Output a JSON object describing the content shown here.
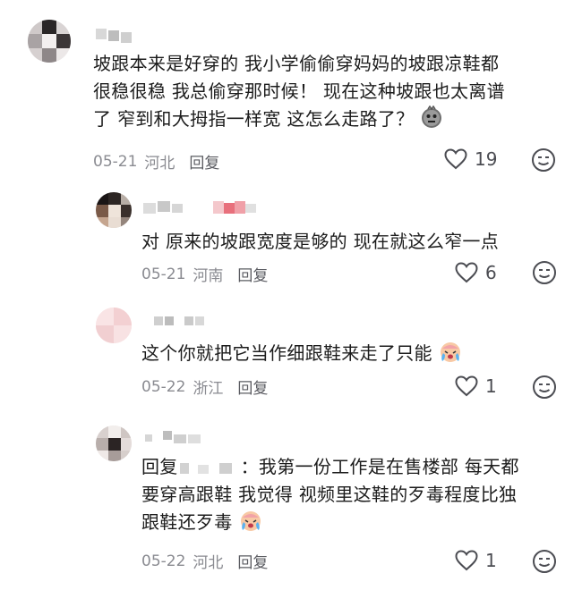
{
  "comments": [
    {
      "text_lines": [
        "坡跟本来是好穿的 我小学偷偷穿妈妈的坡跟凉鞋都",
        "很稳很稳 我总偷穿那时候！ 现在这种坡跟也太离谱",
        "了 窄到和大拇指一样宽 这怎么走路了？"
      ],
      "emoji": "neutral-face-emoji",
      "date": "05-21",
      "location": "河北",
      "reply_label": "回复",
      "likes": "19"
    },
    {
      "text_lines": [
        "对 原来的坡跟宽度是够的 现在就这么窄一点"
      ],
      "date": "05-21",
      "location": "河南",
      "reply_label": "回复",
      "likes": "6"
    },
    {
      "text_lines": [
        "这个你就把它当作细跟鞋来走了只能"
      ],
      "emoji": "crying-face-emoji",
      "date": "05-22",
      "location": "浙江",
      "reply_label": "回复",
      "likes": "1"
    },
    {
      "reply_prefix": "回复",
      "reply_colon": "：",
      "text_lines": [
        "我第一份工作是在售楼部 每天都",
        "要穿高跟鞋 我觉得 视频里这鞋的歹毒程度比独",
        "跟鞋还歹毒"
      ],
      "emoji": "crying-face-emoji",
      "date": "05-22",
      "location": "河北",
      "reply_label": "回复",
      "likes": "1"
    }
  ],
  "icons": {
    "like": "heart-outline-icon",
    "react": "smiley-face-icon"
  },
  "colors": {
    "text": "#1c1c1c",
    "meta": "#8a8b91",
    "icon": "#4b4c52"
  }
}
